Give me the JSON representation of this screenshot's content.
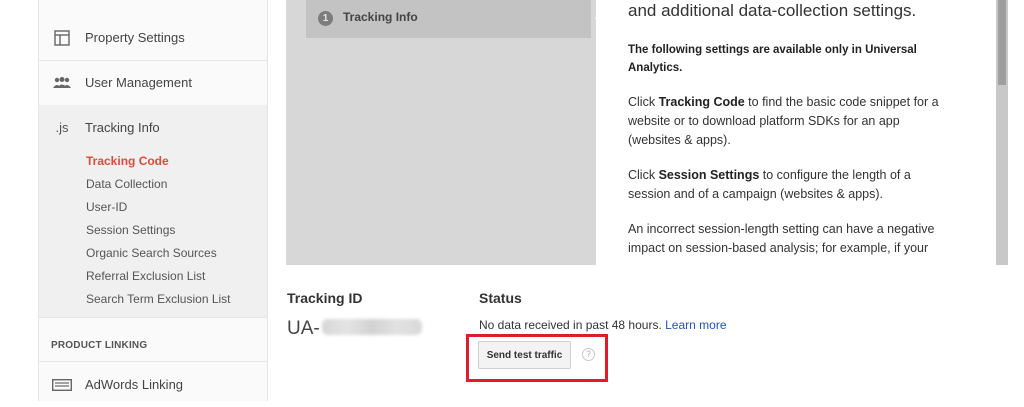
{
  "sidebar": {
    "items": [
      {
        "label": "Property Settings",
        "icon": "property-settings-icon"
      },
      {
        "label": "User Management",
        "icon": "users-icon"
      },
      {
        "label": "Tracking Info",
        "icon": "js-icon",
        "icon_text": ".js"
      }
    ],
    "sub_items": [
      {
        "label": "Tracking Code",
        "active": true
      },
      {
        "label": "Data Collection"
      },
      {
        "label": "User-ID"
      },
      {
        "label": "Session Settings"
      },
      {
        "label": "Organic Search Sources"
      },
      {
        "label": "Referral Exclusion List"
      },
      {
        "label": "Search Term Exclusion List"
      }
    ],
    "section_heading": "PRODUCT LINKING",
    "adwords": {
      "label": "AdWords Linking",
      "icon": "adwords-icon"
    }
  },
  "panel": {
    "step_number": "1",
    "step_label": "Tracking Info",
    "heading": "and additional data-collection settings.",
    "bold_note": "The following settings are available only in Universal Analytics.",
    "p1_pre": "Click ",
    "p1_bold": "Tracking Code",
    "p1_post": " to find the basic code snippet for a website or to download platform SDKs for an app (websites & apps).",
    "p2_pre": "Click ",
    "p2_bold": "Session Settings",
    "p2_post": " to configure the length of a session and of a campaign (websites & apps).",
    "p3": "An incorrect session-length setting can have a negative impact on session-based analysis; for example, if your"
  },
  "tracking": {
    "id_label": "Tracking ID",
    "id_prefix": "UA-",
    "status_label": "Status",
    "status_text": "No data received in past 48 hours.",
    "learn_more": "Learn more",
    "send_test_button": "Send test traffic",
    "help_glyph": "?"
  },
  "colors": {
    "active_link": "#dd4b39",
    "link": "#1a55c9",
    "highlight": "#e01c24"
  }
}
